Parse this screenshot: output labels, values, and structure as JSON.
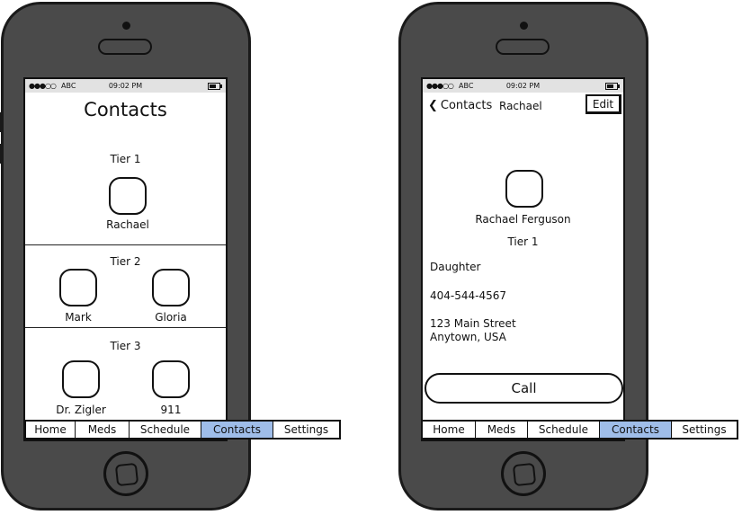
{
  "status_bar": {
    "signal": "●●●○○",
    "carrier": "ABC",
    "time": "09:02 PM"
  },
  "left_screen": {
    "title": "Contacts",
    "tiers": [
      {
        "label": "Tier 1",
        "contacts": [
          "Rachael"
        ]
      },
      {
        "label": "Tier 2",
        "contacts": [
          "Mark",
          "Gloria"
        ]
      },
      {
        "label": "Tier 3",
        "contacts": [
          "Dr. Zigler",
          "911"
        ]
      }
    ]
  },
  "right_screen": {
    "back_label": "Contacts",
    "nav_title": "Rachael",
    "edit_label": "Edit",
    "full_name": "Rachael Ferguson",
    "tier": "Tier 1",
    "relationship": "Daughter",
    "phone": "404-544-4567",
    "address_line1": "123 Main Street",
    "address_line2": "Anytown, USA",
    "call_label": "Call"
  },
  "tabs": [
    "Home",
    "Meds",
    "Schedule",
    "Contacts",
    "Settings"
  ],
  "active_tab": "Contacts",
  "colors": {
    "active_tab": "#9fbde9",
    "phone_body": "#4a4a4a",
    "status_bar": "#e2e2e2"
  }
}
